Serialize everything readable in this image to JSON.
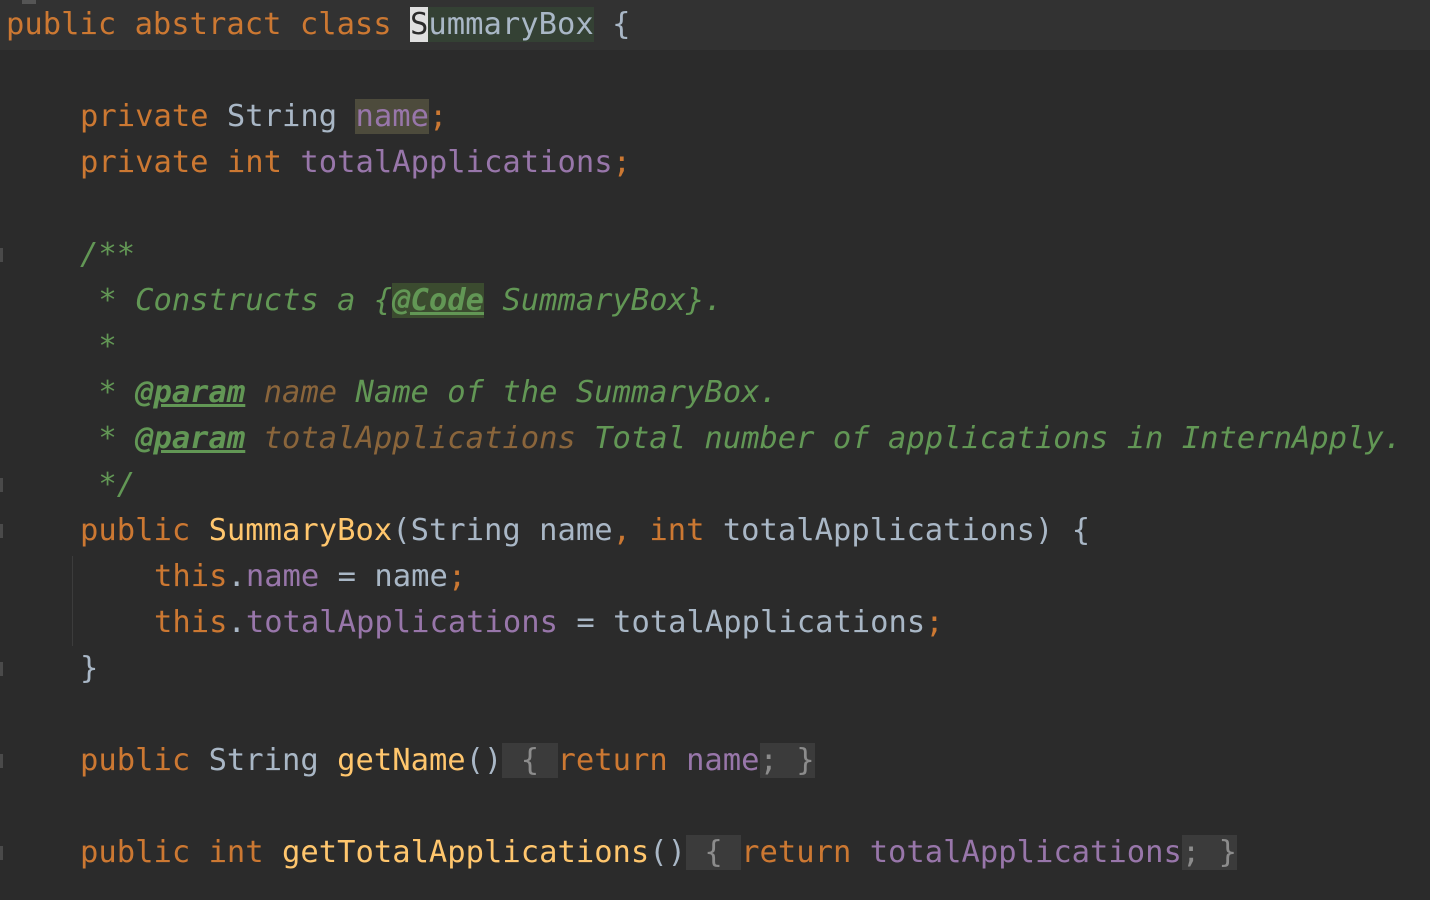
{
  "code": {
    "class_decl": {
      "kw1": "public",
      "kw2": "abstract",
      "kw3": "class",
      "name_caret": "S",
      "name_rest": "ummaryBox",
      "brace": "{"
    },
    "field1": {
      "kw": "private",
      "type": "String",
      "name": "name",
      "semi": ";"
    },
    "field2": {
      "kw": "private",
      "type": "int",
      "name": "totalApplications",
      "semi": ";"
    },
    "javadoc": {
      "open": "/**",
      "line1_pre": " * Constructs a {",
      "line1_tag": "@Code",
      "line1_post": " SummaryBox}.",
      "blank": " *",
      "p1_star": " * ",
      "p1_tag": "@param",
      "p1_name": " name",
      "p1_desc": " Name of the SummaryBox.",
      "p2_star": " * ",
      "p2_tag": "@param",
      "p2_name": " totalApplications",
      "p2_desc": " Total number of applications in InternApply.",
      "close": " */"
    },
    "ctor": {
      "kw": "public",
      "name": "SummaryBox",
      "open": "(",
      "p1_type": "String",
      "p1_name": "name",
      "comma": ",",
      "p2_type": "int",
      "p2_name": "totalApplications",
      "close": ")",
      "brace": "{"
    },
    "assign1": {
      "this": "this",
      "dot": ".",
      "field": "name",
      "eq": " = ",
      "value": "name",
      "semi": ";"
    },
    "assign2": {
      "this": "this",
      "dot": ".",
      "field": "totalApplications",
      "eq": " = ",
      "value": "totalApplications",
      "semi": ";"
    },
    "ctor_close": "}",
    "getName": {
      "kw": "public",
      "type": "String",
      "name": "getName",
      "parens": "()",
      "fold_open": " { ",
      "ret": "return",
      "value": "name",
      "semi": ";",
      "fold_close": " }"
    },
    "getTotal": {
      "kw": "public",
      "type": "int",
      "name": "getTotalApplications",
      "parens": "()",
      "fold_open": " { ",
      "ret": "return",
      "value": "totalApplications",
      "semi": ";",
      "fold_close": " }"
    }
  },
  "colors": {
    "background": "#2b2b2b",
    "keyword": "#cc7832",
    "identifier": "#a9b7c6",
    "field": "#9876aa",
    "method": "#ffc66d",
    "doc_comment": "#629755"
  }
}
